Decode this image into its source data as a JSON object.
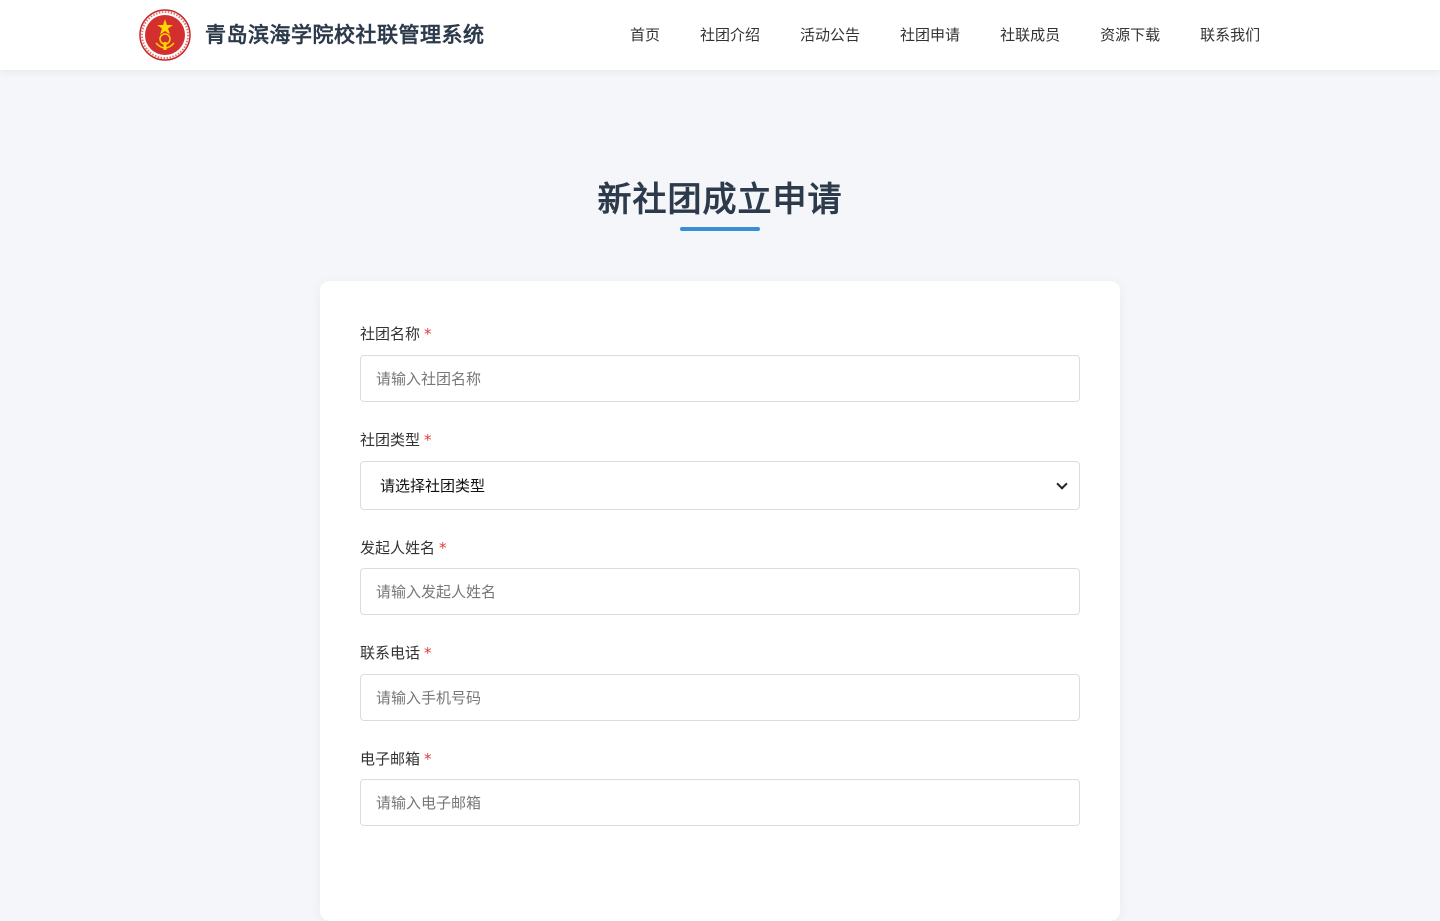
{
  "header": {
    "site_title": "青岛滨海学院校社联管理系统",
    "logo_icon": "school-union-emblem-icon",
    "nav": [
      {
        "label": "首页"
      },
      {
        "label": "社团介绍"
      },
      {
        "label": "活动公告"
      },
      {
        "label": "社团申请"
      },
      {
        "label": "社联成员"
      },
      {
        "label": "资源下载"
      },
      {
        "label": "联系我们"
      }
    ]
  },
  "main": {
    "title": "新社团成立申请",
    "accent_color": "#3a8ed8",
    "form": {
      "required_mark": "*",
      "club_name": {
        "label": "社团名称",
        "placeholder": "请输入社团名称"
      },
      "club_type": {
        "label": "社团类型",
        "selected": "请选择社团类型"
      },
      "founder_name": {
        "label": "发起人姓名",
        "placeholder": "请输入发起人姓名"
      },
      "phone": {
        "label": "联系电话",
        "placeholder": "请输入手机号码"
      },
      "email": {
        "label": "电子邮箱",
        "placeholder": "请输入电子邮箱"
      }
    }
  }
}
